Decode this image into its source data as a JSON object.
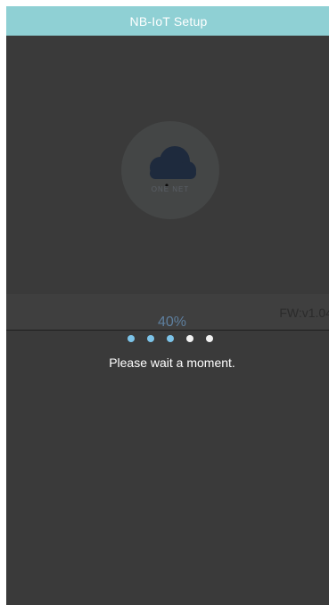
{
  "header": {
    "title": "NB-IoT Setup"
  },
  "logo": {
    "icon": "cloud-icon",
    "caption": "ONE NET"
  },
  "firmware": {
    "version_label": "FW:v1.04"
  },
  "progress": {
    "percent_text": "40%",
    "percent_value": 40,
    "dots": [
      "active",
      "active",
      "active",
      "inactive",
      "inactive"
    ]
  },
  "status": {
    "message": "Please wait a moment."
  },
  "colors": {
    "header_bg": "#8fd0d4",
    "screen_bg": "#3a3a3a",
    "dot_active": "#7cc3e8",
    "dot_inactive": "#f2f2f2",
    "percent_text": "#5e7f9e"
  }
}
